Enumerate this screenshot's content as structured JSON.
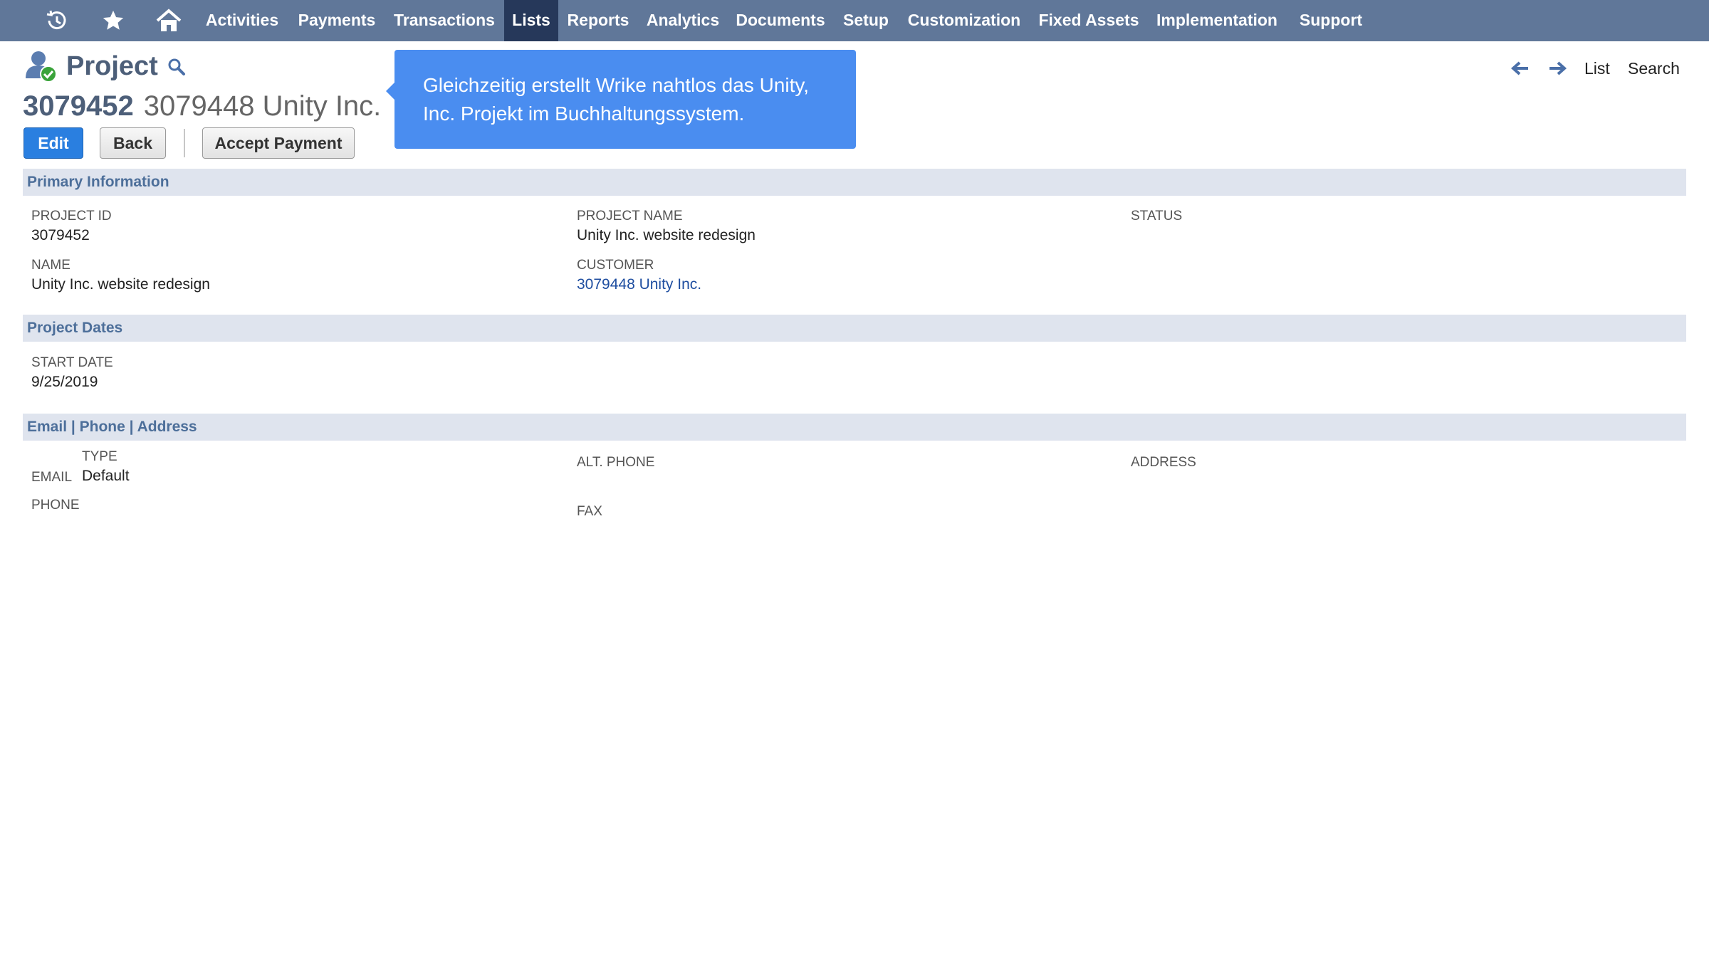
{
  "nav": {
    "items": [
      "Activities",
      "Payments",
      "Transactions",
      "Lists",
      "Reports",
      "Analytics",
      "Documents",
      "Setup",
      "Customization",
      "Fixed Assets",
      "Implementation",
      "Support"
    ],
    "active": "Lists",
    "icons": [
      "history-icon",
      "star-icon",
      "home-icon"
    ]
  },
  "header": {
    "page_title": "Project",
    "record_id": "3079452",
    "record_name": "3079448 Unity Inc."
  },
  "buttons": {
    "edit": "Edit",
    "back": "Back",
    "accept_payment": "Accept Payment"
  },
  "right_nav": {
    "list": "List",
    "search": "Search"
  },
  "tooltip": {
    "line1": "Gleichzeitig erstellt Wrike nahtlos das Unity,",
    "line2": "Inc. Projekt im Buchhaltungssystem."
  },
  "primary": {
    "title": "Primary Information",
    "project_id_label": "PROJECT ID",
    "project_id": "3079452",
    "project_name_label": "PROJECT NAME",
    "project_name": "Unity Inc. website redesign",
    "status_label": "STATUS",
    "name_label": "NAME",
    "name": "Unity Inc. website redesign",
    "customer_label": "CUSTOMER",
    "customer": "3079448 Unity Inc."
  },
  "dates": {
    "title": "Project Dates",
    "start_label": "START DATE",
    "start": "9/25/2019"
  },
  "contact": {
    "tab_email": "Email",
    "tab_phone": "Phone",
    "tab_address": "Address",
    "sep": "|",
    "type_label": "TYPE",
    "email_label": "EMAIL",
    "email_type": "Default",
    "phone_label": "PHONE",
    "alt_phone_label": "ALT. PHONE",
    "fax_label": "FAX",
    "address_label": "ADDRESS"
  },
  "colors": {
    "nav_bg": "#607799",
    "nav_active": "#26385a",
    "accent": "#2a7fe0",
    "tooltip": "#4a8df0",
    "section_bg": "#dfe4ee"
  }
}
